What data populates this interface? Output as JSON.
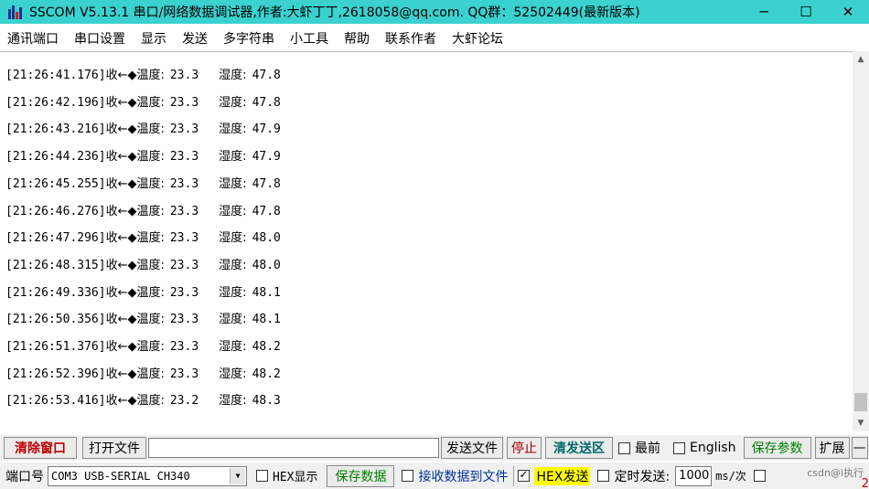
{
  "window": {
    "title": "SSCOM V5.13.1 串口/网络数据调试器,作者:大虾丁丁,2618058@qq.com. QQ群：52502449(最新版本)",
    "minimize": "─",
    "maximize": "☐",
    "close": "✕"
  },
  "menu": {
    "items": [
      "通讯端口",
      "串口设置",
      "显示",
      "发送",
      "多字符串",
      "小工具",
      "帮助",
      "联系作者",
      "大虾论坛"
    ]
  },
  "log": {
    "lines": [
      {
        "time": "[21:26:41.176]",
        "dir": "收←◆",
        "t_label": "温度:",
        "temp": "23.3",
        "h_label": "湿度:",
        "hum": "47.8"
      },
      {
        "time": "[21:26:42.196]",
        "dir": "收←◆",
        "t_label": "温度:",
        "temp": "23.3",
        "h_label": "湿度:",
        "hum": "47.8"
      },
      {
        "time": "[21:26:43.216]",
        "dir": "收←◆",
        "t_label": "温度:",
        "temp": "23.3",
        "h_label": "湿度:",
        "hum": "47.9"
      },
      {
        "time": "[21:26:44.236]",
        "dir": "收←◆",
        "t_label": "温度:",
        "temp": "23.3",
        "h_label": "湿度:",
        "hum": "47.9"
      },
      {
        "time": "[21:26:45.255]",
        "dir": "收←◆",
        "t_label": "温度:",
        "temp": "23.3",
        "h_label": "湿度:",
        "hum": "47.8"
      },
      {
        "time": "[21:26:46.276]",
        "dir": "收←◆",
        "t_label": "温度:",
        "temp": "23.3",
        "h_label": "湿度:",
        "hum": "47.8"
      },
      {
        "time": "[21:26:47.296]",
        "dir": "收←◆",
        "t_label": "温度:",
        "temp": "23.3",
        "h_label": "湿度:",
        "hum": "48.0"
      },
      {
        "time": "[21:26:48.315]",
        "dir": "收←◆",
        "t_label": "温度:",
        "temp": "23.3",
        "h_label": "湿度:",
        "hum": "48.0"
      },
      {
        "time": "[21:26:49.336]",
        "dir": "收←◆",
        "t_label": "温度:",
        "temp": "23.3",
        "h_label": "湿度:",
        "hum": "48.1"
      },
      {
        "time": "[21:26:50.356]",
        "dir": "收←◆",
        "t_label": "温度:",
        "temp": "23.3",
        "h_label": "湿度:",
        "hum": "48.1"
      },
      {
        "time": "[21:26:51.376]",
        "dir": "收←◆",
        "t_label": "温度:",
        "temp": "23.3",
        "h_label": "湿度:",
        "hum": "48.2"
      },
      {
        "time": "[21:26:52.396]",
        "dir": "收←◆",
        "t_label": "温度:",
        "temp": "23.3",
        "h_label": "湿度:",
        "hum": "48.2"
      },
      {
        "time": "[21:26:53.416]",
        "dir": "收←◆",
        "t_label": "温度:",
        "temp": "23.2",
        "h_label": "湿度:",
        "hum": "48.3"
      }
    ]
  },
  "scrollbar": {
    "up": "▲",
    "down": "▼"
  },
  "toolbar1": {
    "clear_window": "清除窗口",
    "open_file": "打开文件",
    "file_path": "",
    "send_file": "发送文件",
    "stop": "停止",
    "clear_send": "清发送区",
    "topmost": "最前",
    "english": "English",
    "save_params": "保存参数",
    "expand": "扩展",
    "collapse": "—"
  },
  "toolbar2": {
    "port_label": "端口号",
    "port_value": "COM3 USB-SERIAL CH340",
    "hex_display": "HEX显示",
    "save_data": "保存数据",
    "recv_to_file": "接收数据到文件",
    "hex_send": "HEX发送",
    "timed_send": "定时发送:",
    "interval": "1000",
    "unit": "ms/次",
    "watermark": "csdn@i执行",
    "red_digit": "2"
  },
  "colors": {
    "titlebar": "#3ad1cf",
    "green_button": "#008000",
    "red_button": "#c00000",
    "hex_highlight": "#ffff00"
  }
}
